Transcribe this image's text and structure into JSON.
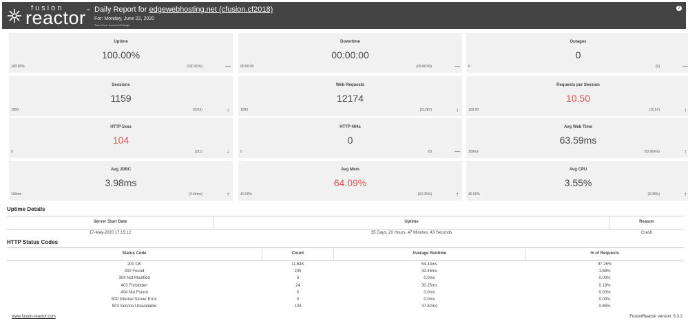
{
  "header": {
    "logo_small": "fusion",
    "logo_big": "reactor",
    "logo_tm": "™",
    "title_prefix": "Daily Report for",
    "title_link": "edgewebhosting.net (cfusion.cf2018)",
    "date": "For: Monday, June 22, 2020",
    "timezone": "Time Zone: America/Chicago",
    "help_icon": "?"
  },
  "tiles": [
    {
      "label": "Uptime",
      "value": "100.00%",
      "base": "100.00%",
      "prev": "(100.00%)",
      "trend": "—",
      "red": false
    },
    {
      "label": "Downtime",
      "value": "00:00:00",
      "base": "00:00:00",
      "prev": "(00:00:00)",
      "trend": "—",
      "red": false
    },
    {
      "label": "Outages",
      "value": "0",
      "base": "0",
      "prev": "(0)",
      "trend": "—",
      "red": false
    },
    {
      "label": "Sessions",
      "value": "1159",
      "base": "1000",
      "prev": "(2013)",
      "trend": "↓",
      "red": false
    },
    {
      "label": "Web Requests",
      "value": "12174",
      "base": "1000",
      "prev": "(21287)",
      "trend": "↓",
      "red": false
    },
    {
      "label": "Requests per Session",
      "value": "10.50",
      "base": "100.00",
      "prev": "(10.57)",
      "trend": "↓",
      "red": true
    },
    {
      "label": "HTTP 5xxs",
      "value": "104",
      "base": "0",
      "prev": "(211)",
      "trend": "↓",
      "red": true
    },
    {
      "label": "HTTP 404s",
      "value": "0",
      "base": "0",
      "prev": "(0)",
      "trend": "—",
      "red": false
    },
    {
      "label": "Avg Web Time",
      "value": "63.59ms",
      "base": "100ms",
      "prev": "(52.89ms)",
      "trend": "↑",
      "red": false
    },
    {
      "label": "Avg JDBC",
      "value": "3.98ms",
      "base": "100ms",
      "prev": "(3.44ms)",
      "trend": "↑",
      "red": false
    },
    {
      "label": "Avg Mem",
      "value": "64.09%",
      "base": "40.00%",
      "prev": "(62.05%)",
      "trend": "↑",
      "red": true
    },
    {
      "label": "Avg CPU",
      "value": "3.55%",
      "base": "40.00%",
      "prev": "(3.08%)",
      "trend": "↑",
      "red": false
    }
  ],
  "uptime_details": {
    "title": "Uptime Details",
    "headers": [
      "Server Start Date",
      "Uptime",
      "Reason"
    ],
    "row": [
      "17-May-2020 17:15:12",
      "35 Days, 20 Hours, 47 Minutes, 43 Seconds",
      "Crash"
    ]
  },
  "status_codes": {
    "title": "HTTP Status Codes",
    "headers": [
      "Status Code",
      "Count",
      "Average Runtime",
      "% of Requests"
    ],
    "rows": [
      [
        "200 OK",
        "11.84K",
        "64.43ms",
        "97.26%"
      ],
      [
        "302 Found",
        "205",
        "32.46ms",
        "1.68%"
      ],
      [
        "304 Not Modified",
        "0",
        "0.0ms",
        "0.00%"
      ],
      [
        "403 Forbidden",
        "24",
        "30.25ms",
        "0.19%"
      ],
      [
        "404 Not Found",
        "0",
        "0.0ms",
        "0.00%"
      ],
      [
        "500 Internal Server Error",
        "0",
        "0.0ms",
        "0.00%"
      ],
      [
        "503 Service Unavailable",
        "104",
        "37.82ms",
        "0.85%"
      ]
    ]
  },
  "footer": {
    "link": "www.fusion-reactor.com",
    "version": "FusionReactor version: 8.3.2"
  }
}
